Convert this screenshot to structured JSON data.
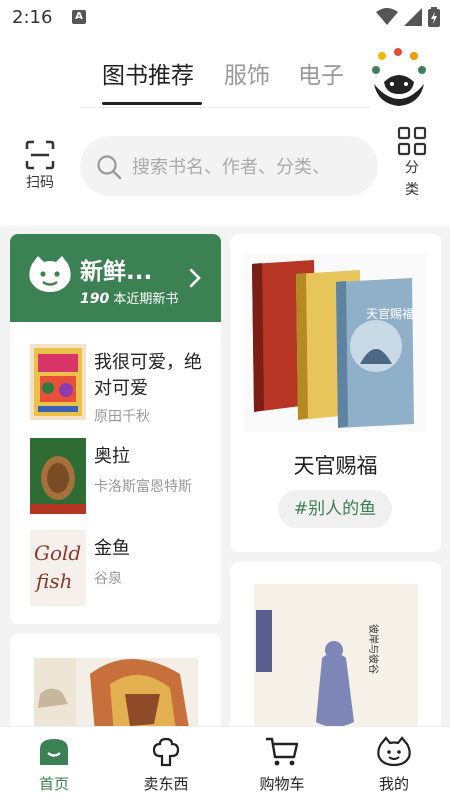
{
  "status": {
    "time": "2:16",
    "a_badge": "A"
  },
  "header": {
    "tabs": [
      {
        "label": "图书推荐",
        "active": true
      },
      {
        "label": "服饰",
        "active": false
      },
      {
        "label": "电子",
        "active": false
      }
    ]
  },
  "toolbar": {
    "scan_label": "扫码",
    "search_placeholder": "搜索书名、作者、分类、",
    "category_label_line1": "分",
    "category_label_line2": "类"
  },
  "fresh": {
    "title": "新鲜...",
    "count": "190",
    "subtitle": "本近期新书"
  },
  "books": [
    {
      "title": "我很可爱，绝对可爱",
      "author": "原田千秋"
    },
    {
      "title": "奥拉",
      "author": "卡洛斯富恩特斯"
    },
    {
      "title": "金鱼",
      "author": "谷泉",
      "cover_text_1": "Gold",
      "cover_text_2": "fish"
    }
  ],
  "featured": {
    "title": "天官赐福",
    "tag": "#别人的鱼",
    "cover_text": "天官赐福"
  },
  "second_book": {
    "cover_title": "彼岸与彼谷"
  },
  "bottom_nav": [
    {
      "label": "首页",
      "active": true,
      "icon": "home-icon"
    },
    {
      "label": "卖东西",
      "active": false,
      "icon": "sell-icon"
    },
    {
      "label": "购物车",
      "active": false,
      "icon": "cart-icon"
    },
    {
      "label": "我的",
      "active": false,
      "icon": "profile-icon"
    }
  ],
  "colors": {
    "brand_green": "#3c8153"
  }
}
